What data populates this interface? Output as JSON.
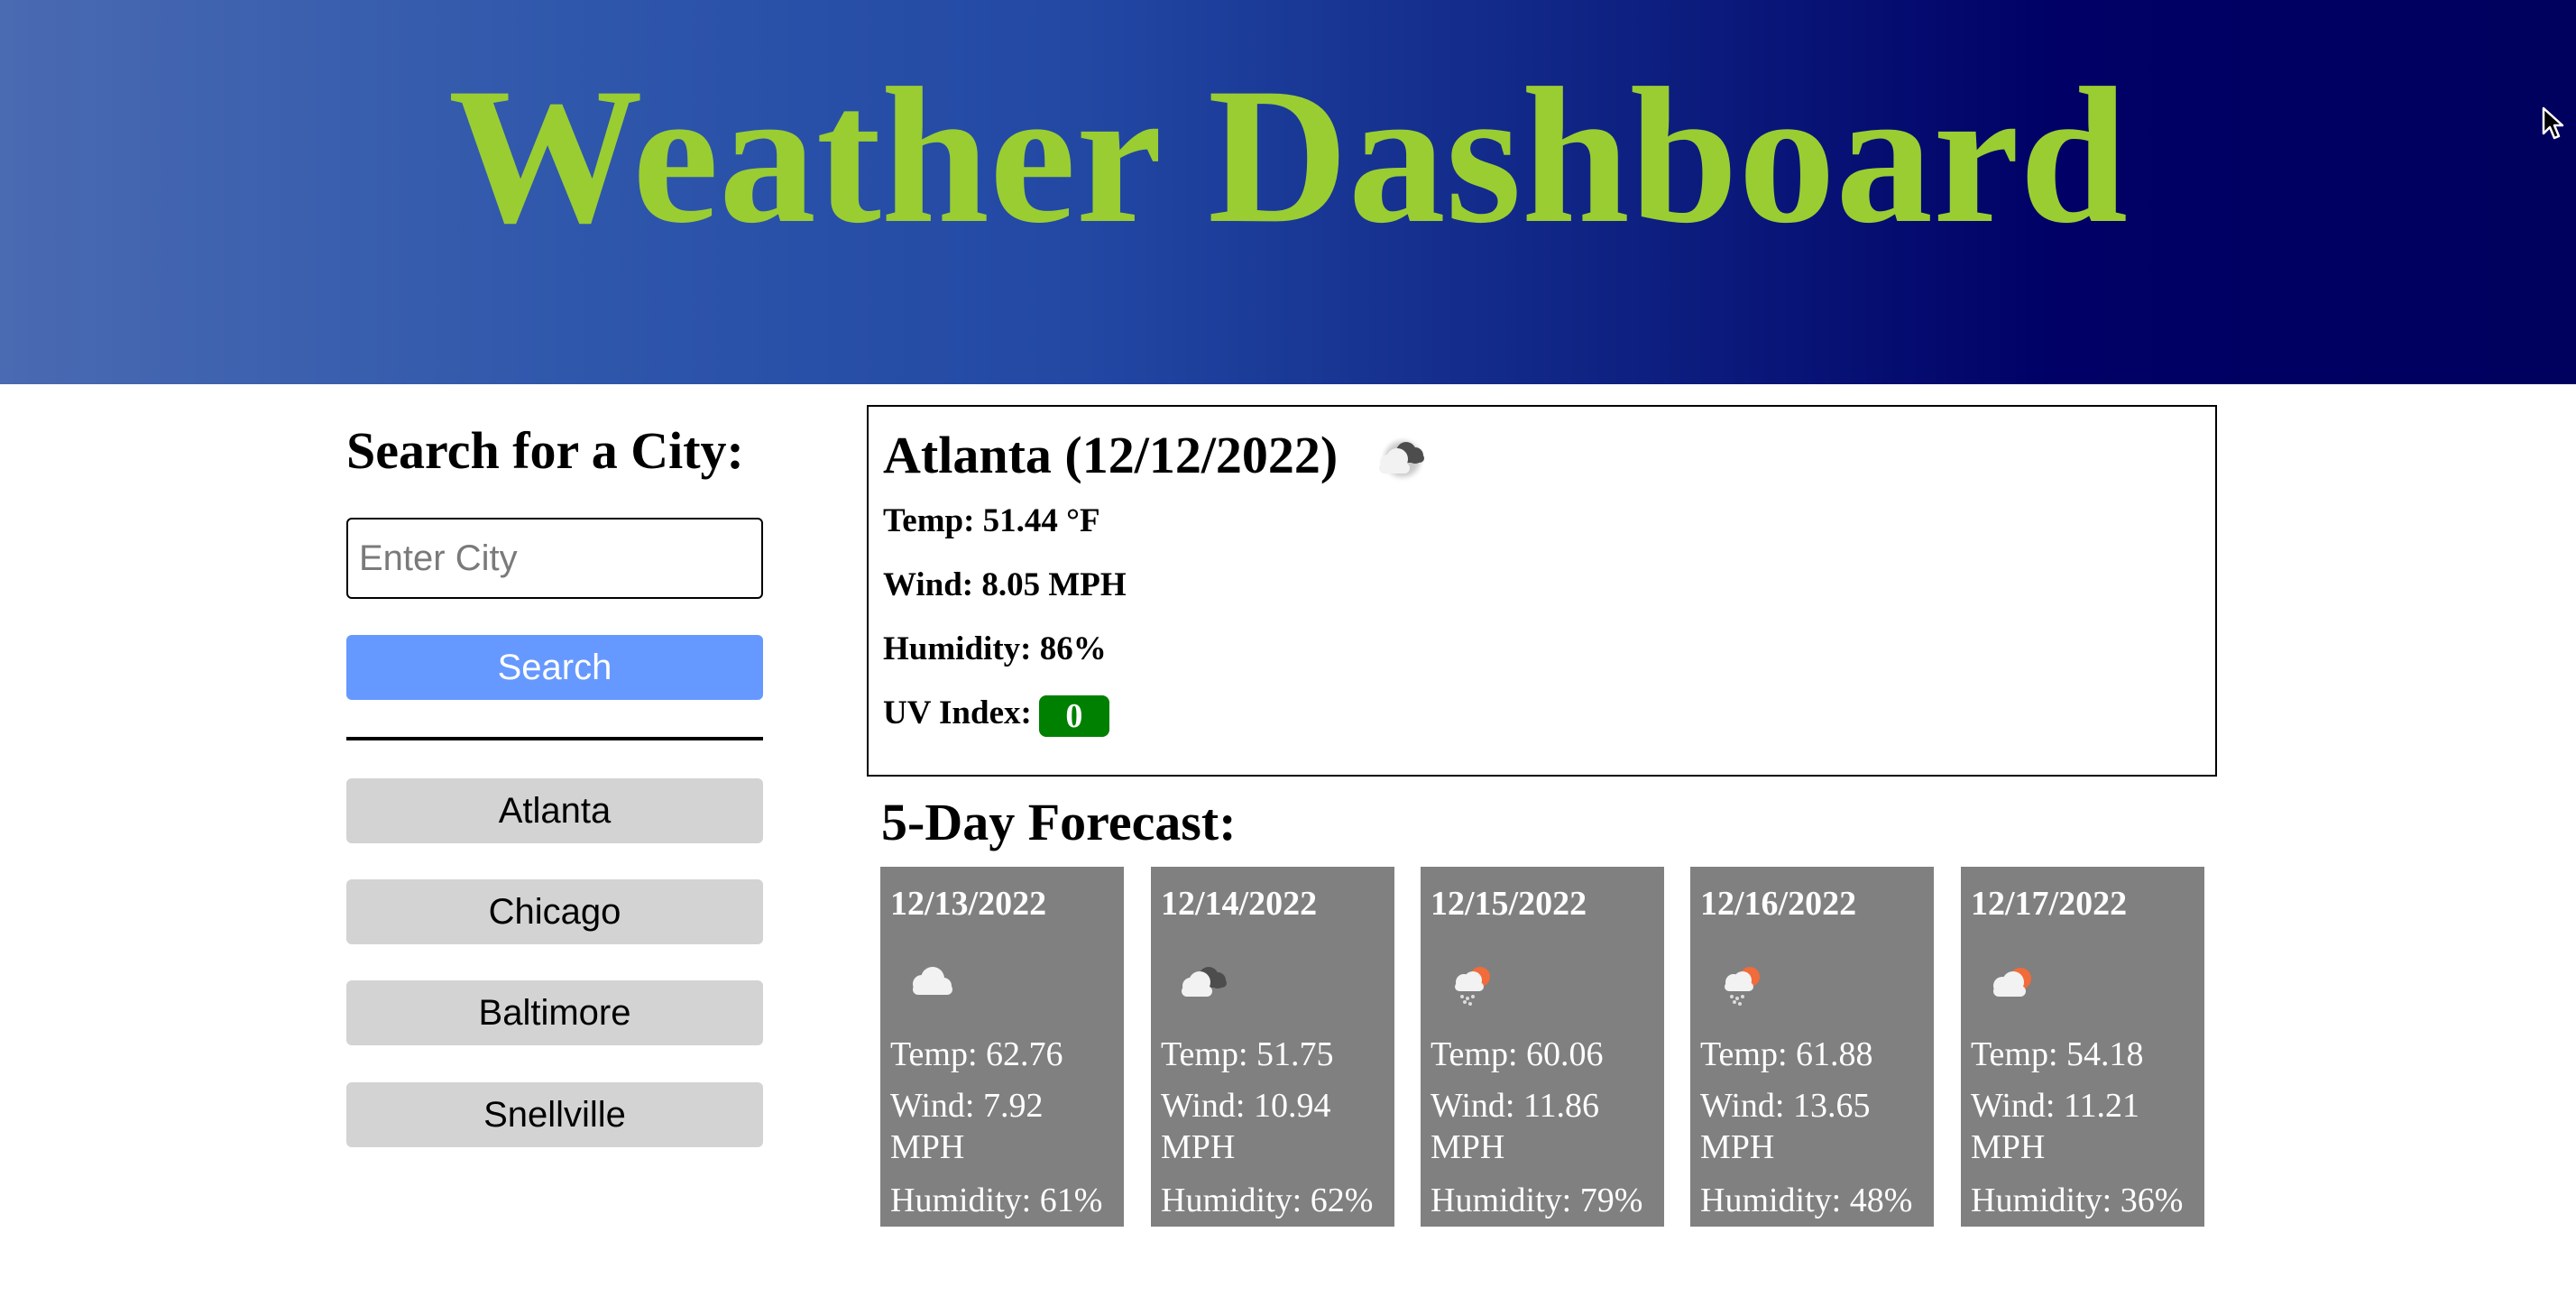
{
  "header": {
    "title": "Weather Dashboard"
  },
  "sidebar": {
    "heading": "Search for a City:",
    "input_placeholder": "Enter City",
    "input_value": "",
    "search_label": "Search",
    "history": [
      "Atlanta",
      "Chicago",
      "Baltimore",
      "Snellville"
    ]
  },
  "current": {
    "title": "Atlanta (12/12/2022)",
    "icon": "broken-clouds-icon",
    "temp": "Temp: 51.44 °F",
    "wind": "Wind: 8.05 MPH",
    "humidity": "Humidity: 86%",
    "uv_label": "UV Index:",
    "uv_value": "0",
    "uv_color": "#008000"
  },
  "forecast": {
    "heading": "5-Day Forecast:",
    "days": [
      {
        "date": "12/13/2022",
        "icon": "cloud-icon",
        "temp": "Temp: 62.76",
        "wind": "Wind: 7.92 MPH",
        "humidity": "Humidity: 61%"
      },
      {
        "date": "12/14/2022",
        "icon": "broken-clouds-icon",
        "temp": "Temp: 51.75",
        "wind": "Wind: 10.94 MPH",
        "humidity": "Humidity: 62%"
      },
      {
        "date": "12/15/2022",
        "icon": "sun-rain-icon",
        "temp": "Temp: 60.06",
        "wind": "Wind: 11.86 MPH",
        "humidity": "Humidity: 79%"
      },
      {
        "date": "12/16/2022",
        "icon": "sun-rain-icon",
        "temp": "Temp: 61.88",
        "wind": "Wind: 13.65 MPH",
        "humidity": "Humidity: 48%"
      },
      {
        "date": "12/17/2022",
        "icon": "sun-cloud-icon",
        "temp": "Temp: 54.18",
        "wind": "Wind: 11.21 MPH",
        "humidity": "Humidity: 36%"
      }
    ]
  },
  "colors": {
    "title": "#9acd32",
    "search_button": "#6699ff",
    "history_button": "#d3d3d3",
    "forecast_card": "#808080"
  }
}
